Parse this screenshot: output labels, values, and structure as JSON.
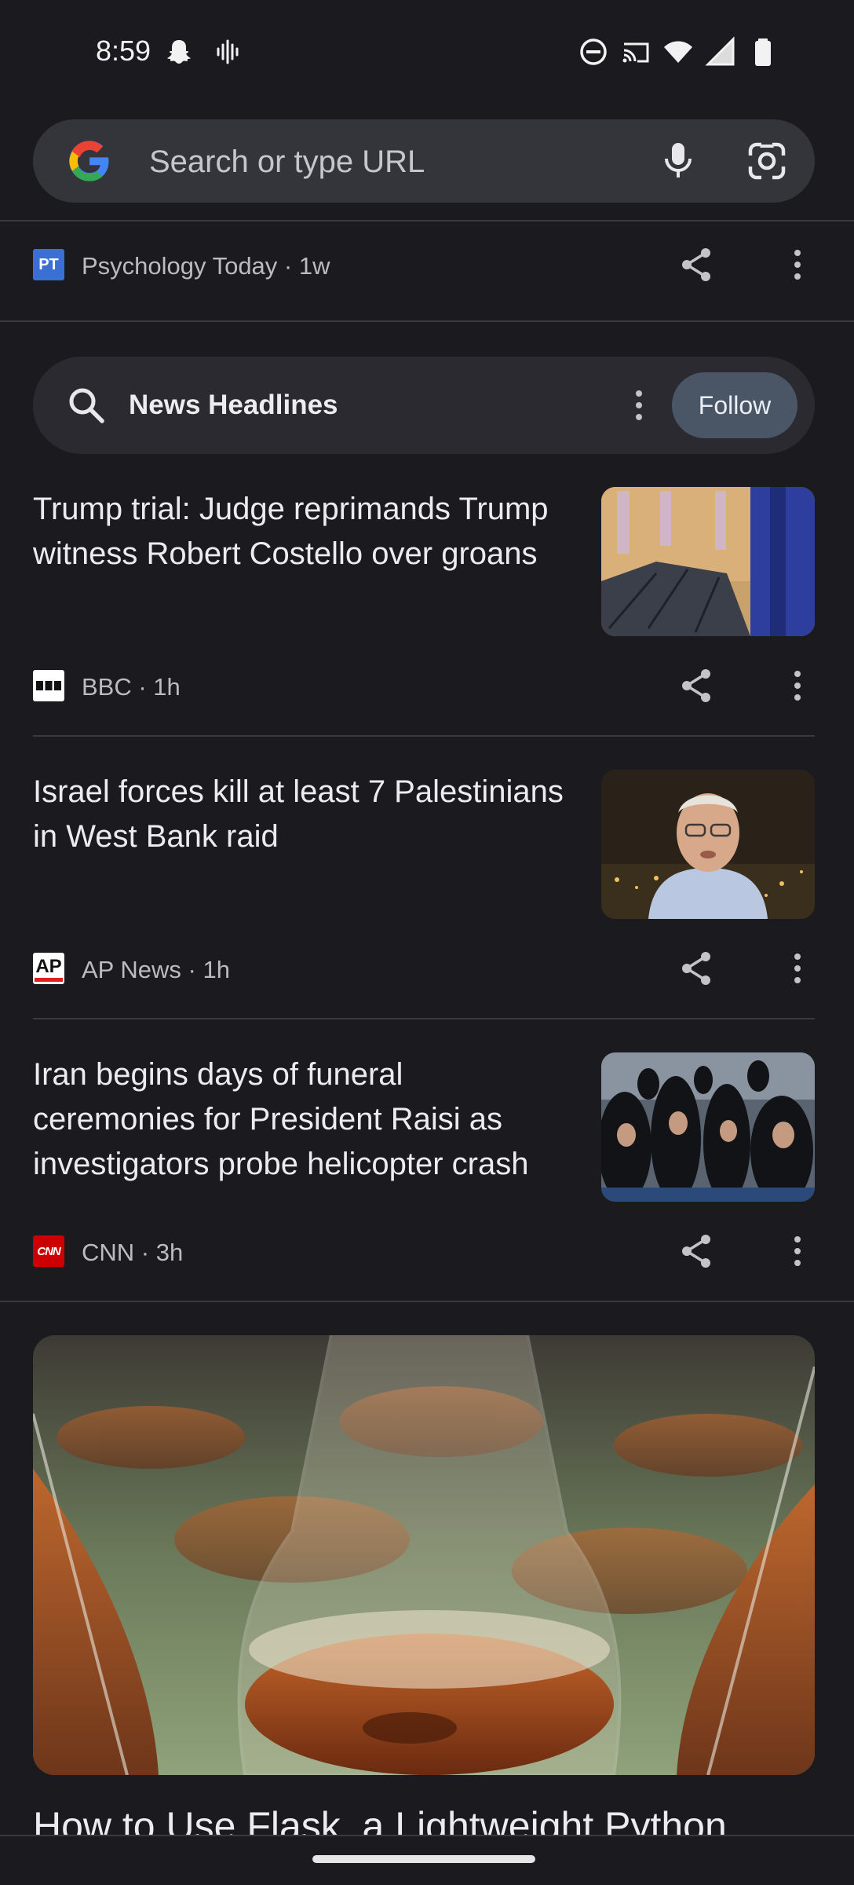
{
  "status_bar": {
    "time": "8:59",
    "left_icons": [
      "snapchat-icon",
      "voice-activity-icon"
    ],
    "right_icons": [
      "do-not-disturb-icon",
      "cast-icon",
      "wifi-icon",
      "signal-icon",
      "battery-icon"
    ]
  },
  "search": {
    "placeholder": "Search or type URL",
    "icons": [
      "google-logo-icon",
      "microphone-icon",
      "google-lens-icon"
    ]
  },
  "top_source": {
    "logo_text": "PT",
    "meta": "Psychology Today · 1w"
  },
  "topic": {
    "label": "News Headlines",
    "follow_label": "Follow"
  },
  "articles": [
    {
      "title": "Trump trial: Judge reprimands Trump witness Robert Costello over groans",
      "source_logo": "BBC",
      "meta": "BBC · 1h"
    },
    {
      "title": "Israel forces kill at least 7 Palestinians in West Bank raid",
      "source_logo": "AP",
      "meta": "AP News · 1h"
    },
    {
      "title": "Iran begins days of funeral ceremonies for President Raisi as investigators probe helicopter crash",
      "source_logo": "CNN",
      "meta": "CNN · 3h"
    }
  ],
  "feature": {
    "title_partial": "How to Use Flask, a Lightweight Python"
  },
  "colors": {
    "background": "#1b1b1f",
    "search_bar": "#34343b",
    "follow_button": "#4a5565"
  }
}
